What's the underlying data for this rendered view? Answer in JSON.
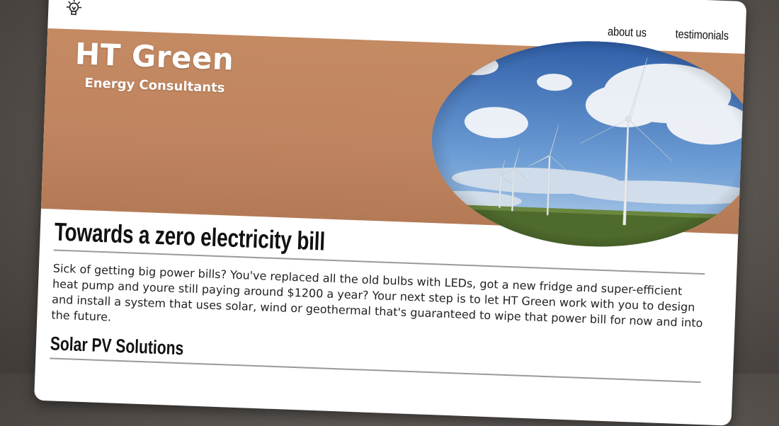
{
  "header": {
    "logo_icon": "lightbulb-icon",
    "nav": [
      {
        "label": "about us"
      },
      {
        "label": "testimonials"
      }
    ]
  },
  "hero": {
    "title": "HT Green",
    "subtitle": "Energy Consultants",
    "image": "wind-turbines-photo"
  },
  "main": {
    "heading": "Towards a zero electricity bill",
    "intro": "Sick of getting big power bills? You've replaced all the old bulbs with LEDs, got a new fridge and super-efficient heat pump and youre still paying around $1200 a year? Your next step is to let HT Green work with you to design and install a system that uses solar, wind or geothermal that's guaranteed to wipe that power bill for now and into the future.",
    "section_heading": "Solar PV Solutions"
  },
  "colors": {
    "hero_bg": "#c48a62",
    "background": "#55504c",
    "text": "#222222"
  }
}
